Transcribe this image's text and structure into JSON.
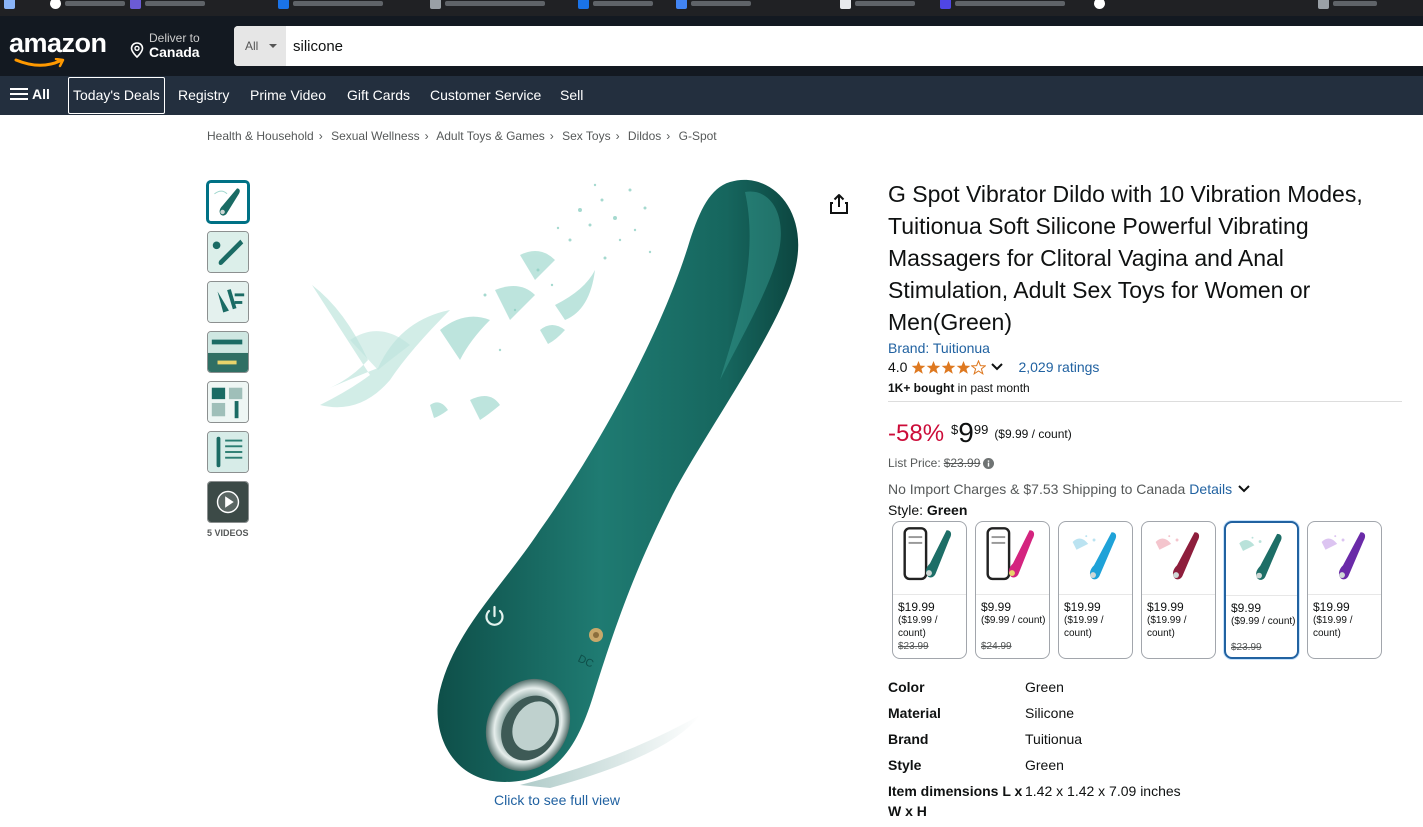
{
  "header": {
    "logo": "amazon",
    "deliver_line1": "Deliver to",
    "deliver_line2": "Canada",
    "search_category": "All",
    "search_value": "silicone"
  },
  "nav": {
    "all_label": "All",
    "items": [
      "Today's Deals",
      "Registry",
      "Prime Video",
      "Gift Cards",
      "Customer Service",
      "Sell"
    ]
  },
  "breadcrumbs": [
    "Health & Household",
    "Sexual Wellness",
    "Adult Toys & Games",
    "Sex Toys",
    "Dildos",
    "G-Spot"
  ],
  "gallery": {
    "videos_label": "5 VIDEOS",
    "full_view": "Click to see full view"
  },
  "product": {
    "title": "G Spot Vibrator Dildo with 10 Vibration Modes, Tuitionua Soft Silicone Powerful Vibrating Massagers for Clitoral Vagina and Anal Stimulation, Adult Sex Toys for Women or Men(Green)",
    "brand": "Brand: Tuitionua",
    "rating": "4.0",
    "stars": 4.0,
    "ratings_count": "2,029 ratings",
    "bought_bold": "1K+ bought",
    "bought_rest": " in past month",
    "discount": "-58%",
    "currency": "$",
    "price_whole": "9",
    "price_fraction": "99",
    "unit_price": "($9.99 / count)",
    "list_price_label": "List Price:",
    "list_price": "$23.99",
    "shipping": "No Import Charges & $7.53 Shipping to Canada",
    "details_link": "Details",
    "style_label": "Style:",
    "style_value": "Green"
  },
  "variants": [
    {
      "price": "$19.99",
      "unit": "($19.99 / count)",
      "old": "$23.99",
      "color": "#1d6e67"
    },
    {
      "price": "$9.99",
      "unit": "($9.99 / count)",
      "old": "$24.99",
      "color": "#d4247f"
    },
    {
      "price": "$19.99",
      "unit": "($19.99 / count)",
      "old": "",
      "color": "#1fa2d8"
    },
    {
      "price": "$19.99",
      "unit": "($19.99 / count)",
      "old": "",
      "color": "#8e1e3c"
    },
    {
      "price": "$9.99",
      "unit": "($9.99 / count)",
      "old": "$23.99",
      "color": "#1d6e67"
    },
    {
      "price": "$19.99",
      "unit": "($19.99 / count)",
      "old": "",
      "color": "#6a2aa8"
    }
  ],
  "specs": [
    {
      "key": "Color",
      "value": "Green"
    },
    {
      "key": "Material",
      "value": "Silicone"
    },
    {
      "key": "Brand",
      "value": "Tuitionua"
    },
    {
      "key": "Style",
      "value": "Green"
    },
    {
      "key": "Item dimensions L x W x H",
      "value": "1.42 x 1.42 x 7.09 inches"
    }
  ],
  "colors": {
    "header_bg": "#131921",
    "nav_bg": "#232f3e",
    "link": "#2162a1",
    "deal_red": "#cc0c39",
    "star": "#de7921",
    "product_teal": "#1a6b64"
  }
}
